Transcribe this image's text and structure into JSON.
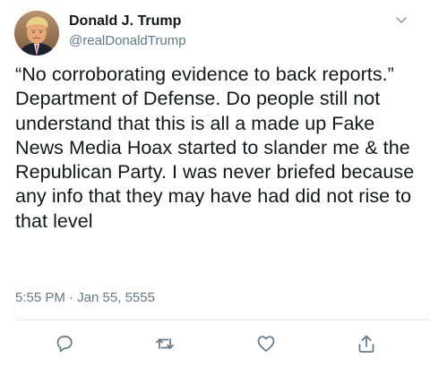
{
  "user": {
    "display_name": "Donald J. Trump",
    "handle": "@realDonaldTrump"
  },
  "tweet": {
    "text": "“No corroborating evidence to back reports.” Department of Defense. Do people still not understand that this is all a made up Fake News Media Hoax started to slander me & the Republican Party. I was never briefed because any info that they may have had did not rise to that level",
    "timestamp": "5:55 PM · Jan 55, 5555"
  },
  "icons": {
    "menu": "chevron-down-icon",
    "reply": "reply-icon",
    "retweet": "retweet-icon",
    "like": "heart-icon",
    "share": "share-icon"
  },
  "colors": {
    "text": "#14171a",
    "secondary": "#657786",
    "divider": "#e1e8ed",
    "icon": "#657786"
  }
}
